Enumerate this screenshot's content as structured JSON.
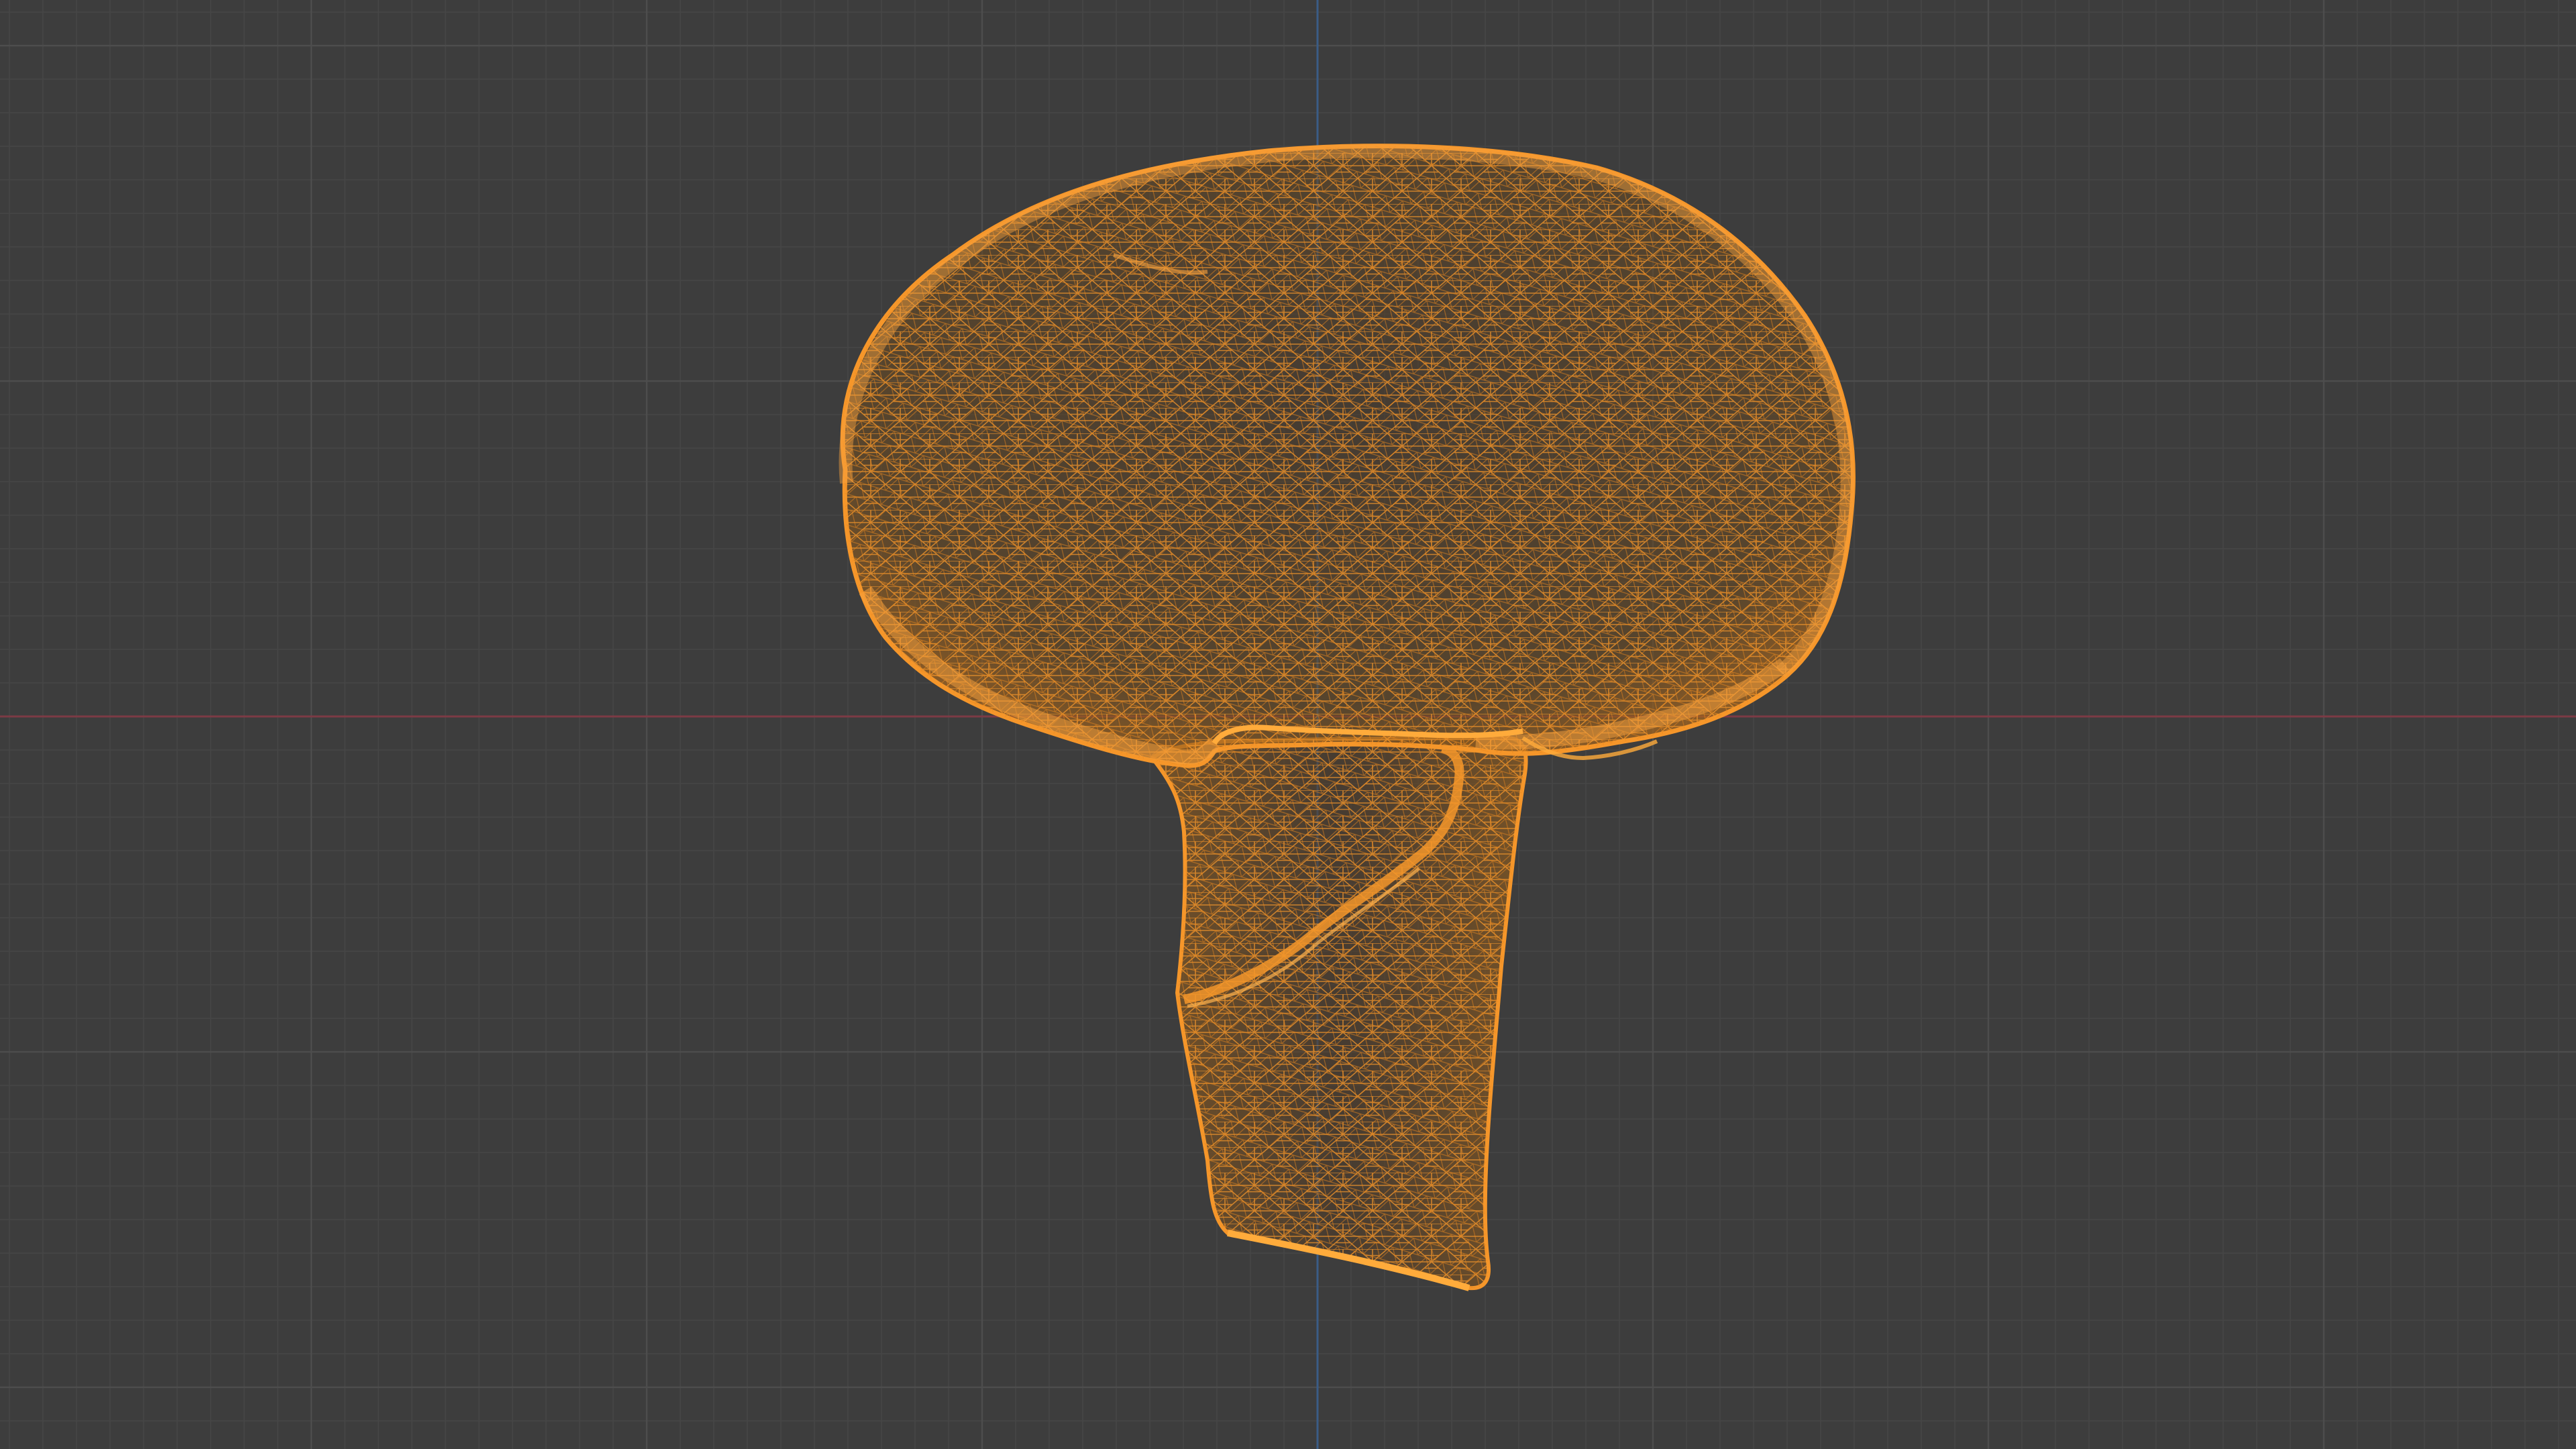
{
  "viewport": {
    "type": "3d-viewport",
    "view_mode": "wireframe",
    "background_color": "#3d3d3d",
    "grid": true,
    "grid_minor_color": "#464646",
    "grid_major_color": "#4d4d4d",
    "x_axis_color": "#7c3a45",
    "z_axis_color": "#3a5c86"
  },
  "object": {
    "name": "mushroom",
    "wire_color": "#f5962a",
    "fill_color": "#5c4324",
    "parts": [
      "cap",
      "stem"
    ]
  }
}
